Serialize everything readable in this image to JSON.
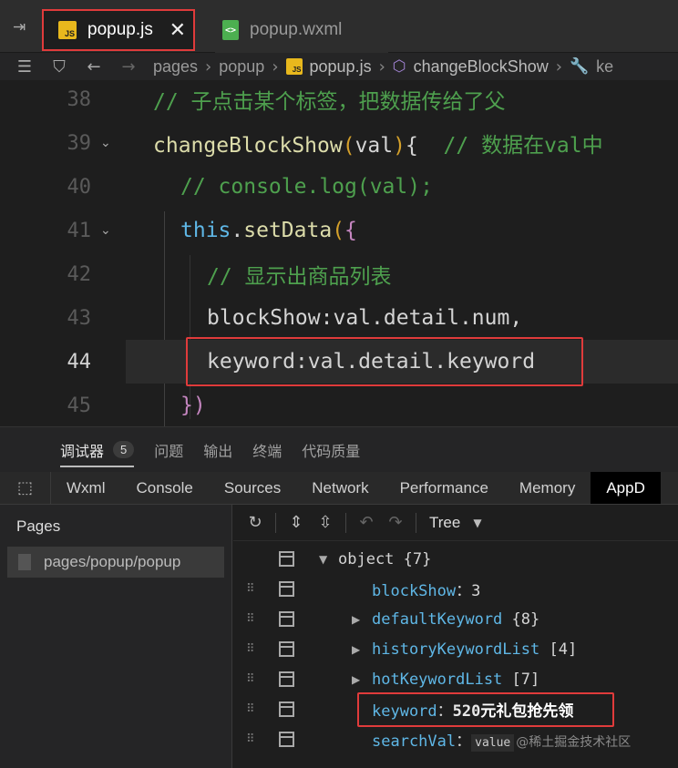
{
  "tabs": {
    "active": {
      "label": "popup.js",
      "close": "✕"
    },
    "inactive": {
      "label": "popup.wxml"
    }
  },
  "breadcrumb": {
    "items": [
      "pages",
      "popup",
      "popup.js",
      "changeBlockShow",
      "ke"
    ]
  },
  "editor": {
    "lines": [
      {
        "num": "38",
        "text": "// 子点击某个标签，把数据传给了父"
      },
      {
        "num": "39",
        "fn": "changeBlockShow",
        "param": "val",
        "comment": "// 数据在val中"
      },
      {
        "num": "40",
        "text": "// console.log(val);"
      },
      {
        "num": "41",
        "this": "this",
        "method": "setData"
      },
      {
        "num": "42",
        "text": "// 显示出商品列表"
      },
      {
        "num": "43",
        "prop": "blockShow",
        "value": "val.detail.num"
      },
      {
        "num": "44",
        "prop": "keyword",
        "value": "val.detail.keyword"
      },
      {
        "num": "45",
        "close": "})"
      }
    ]
  },
  "debugger": {
    "tabs": [
      "调试器",
      "问题",
      "输出",
      "终端",
      "代码质量"
    ],
    "badge": "5"
  },
  "devtools": {
    "tabs": [
      "Wxml",
      "Console",
      "Sources",
      "Network",
      "Performance",
      "Memory",
      "AppD"
    ]
  },
  "pages_panel": {
    "title": "Pages",
    "item": "pages/popup/popup"
  },
  "tree": {
    "mode": "Tree",
    "root": {
      "key": "object",
      "count": "{7}"
    },
    "rows": [
      {
        "key": "blockShow",
        "value": "3"
      },
      {
        "key": "defaultKeyword",
        "count": "{8}"
      },
      {
        "key": "historyKeywordList",
        "count": "[4]"
      },
      {
        "key": "hotKeywordList",
        "count": "[7]"
      },
      {
        "key": "keyword",
        "value_num": "520",
        "value_text": "元礼包抢先领"
      },
      {
        "key": "searchVal",
        "chip": "value",
        "watermark": "@稀土掘金技术社区"
      }
    ]
  },
  "colors": {
    "highlight": "#e03b3b",
    "key": "#5fb7e6",
    "comment": "#4ea04e"
  }
}
